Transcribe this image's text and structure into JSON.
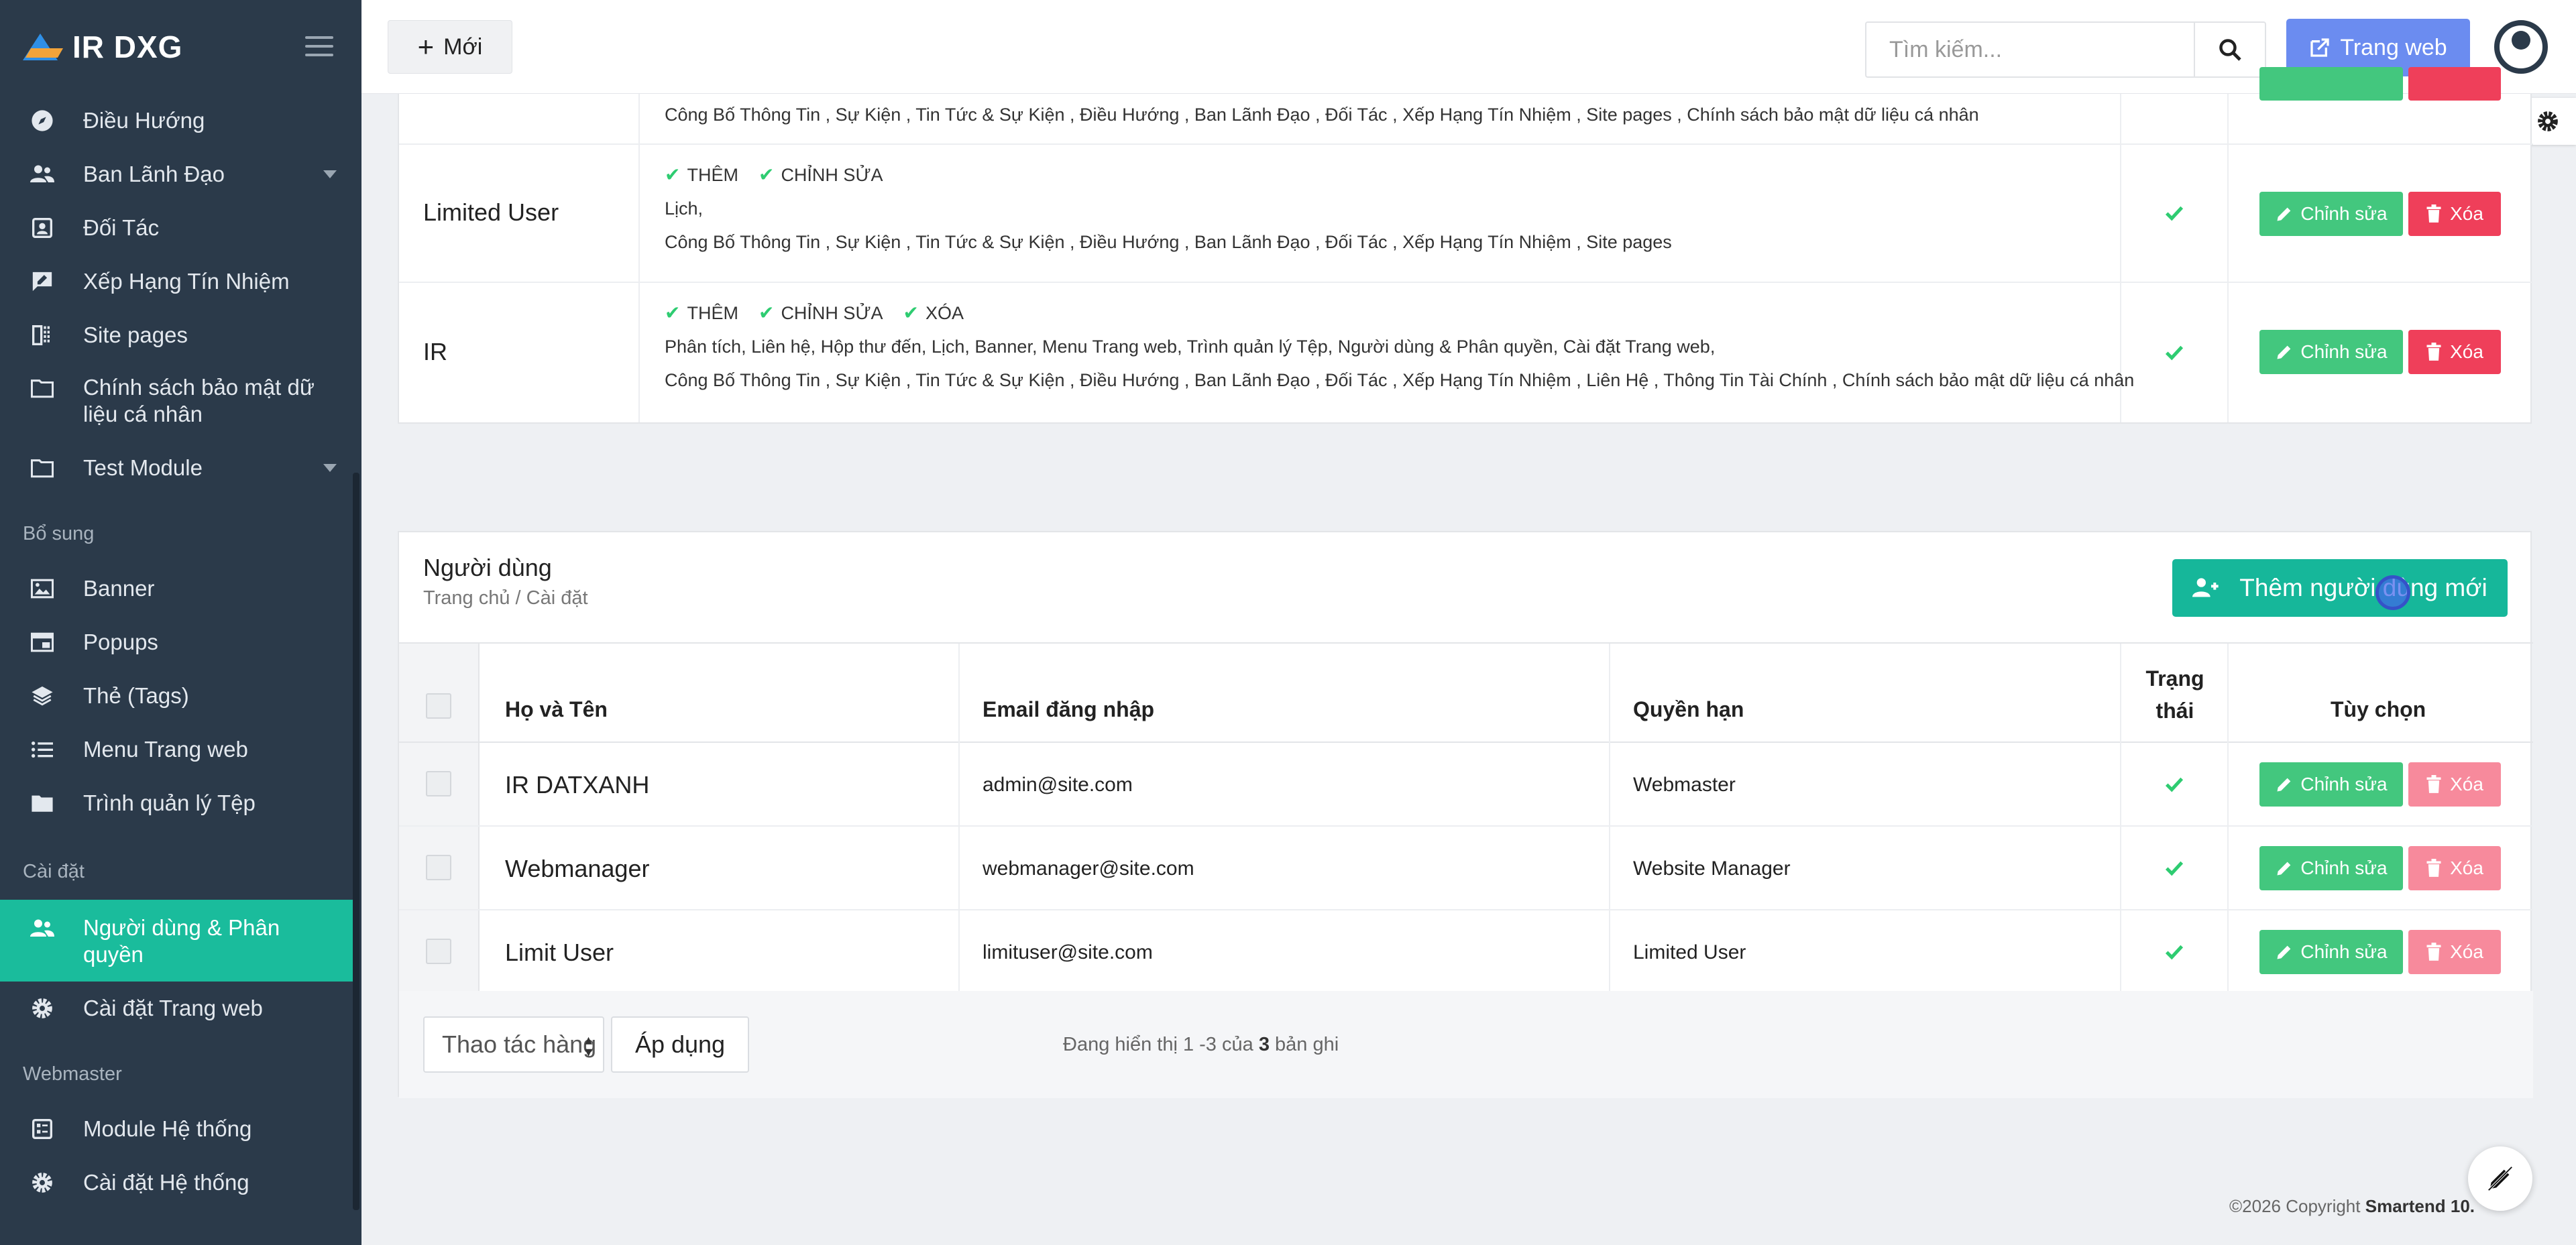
{
  "app": {
    "title": "IR DXG"
  },
  "sidebar": {
    "items": [
      {
        "label": "Điều Hướng",
        "icon": "compass-icon"
      },
      {
        "label": "Ban Lãnh Đạo",
        "icon": "users-icon"
      },
      {
        "label": "Đối Tác",
        "icon": "id-card-icon"
      },
      {
        "label": "Xếp Hạng Tín Nhiệm",
        "icon": "signature-icon"
      },
      {
        "label": "Site pages",
        "icon": "columns-icon"
      },
      {
        "label": "Chính sách bảo mật dữ liệu cá nhân",
        "icon": "folder-icon"
      },
      {
        "label": "Test Module",
        "icon": "folder-icon"
      }
    ],
    "section_extra": "Bổ sung",
    "extra_items": [
      {
        "label": "Banner",
        "icon": "image-icon"
      },
      {
        "label": "Popups",
        "icon": "window-icon"
      },
      {
        "label": "Thẻ (Tags)",
        "icon": "layers-icon"
      },
      {
        "label": "Menu Trang web",
        "icon": "list-icon"
      },
      {
        "label": "Trình quản lý Tệp",
        "icon": "folder-filled-icon"
      }
    ],
    "section_settings": "Cài đặt",
    "settings_items": [
      {
        "label": "Người dùng & Phân quyền",
        "icon": "users-icon"
      },
      {
        "label": "Cài đặt Trang web",
        "icon": "gear-icon"
      }
    ],
    "section_webmaster": "Webmaster",
    "webmaster_items": [
      {
        "label": "Module Hệ thống",
        "icon": "module-icon"
      },
      {
        "label": "Cài đặt Hệ thống",
        "icon": "gear-icon"
      }
    ]
  },
  "header": {
    "new_label": "Mới",
    "search_placeholder": "Tìm kiếm...",
    "website_label": "Trang web"
  },
  "permissions": {
    "top_row_text": "Công Bố Thông Tin , Sự Kiện , Tin Tức & Sự Kiện , Điều Hướng , Ban Lãnh Đạo , Đối Tác , Xếp Hạng Tín Nhiệm , Site pages , Chính sách bảo mật dữ liệu cá nhân",
    "rows": [
      {
        "name": "Limited User",
        "tags": [
          "THÊM",
          "CHỈNH SỬA"
        ],
        "line1": "Lịch,",
        "line2": "Công Bố Thông Tin , Sự Kiện , Tin Tức & Sự Kiện , Điều Hướng , Ban Lãnh Đạo , Đối Tác , Xếp Hạng Tín Nhiệm , Site pages"
      },
      {
        "name": "IR",
        "tags": [
          "THÊM",
          "CHỈNH SỬA",
          "XÓA"
        ],
        "line1": "Phân tích, Liên hệ, Hộp thư đến, Lịch, Banner, Menu Trang web, Trình quản lý Tệp, Người dùng & Phân quyền, Cài đặt Trang web,",
        "line2": "Công Bố Thông Tin , Sự Kiện , Tin Tức & Sự Kiện , Điều Hướng , Ban Lãnh Đạo , Đối Tác , Xếp Hạng Tín Nhiệm , Liên Hệ , Thông Tin Tài Chính , Chính sách bảo mật dữ liệu cá nhân"
      }
    ]
  },
  "actions": {
    "edit_label": "Chỉnh sửa",
    "delete_label": "Xóa"
  },
  "users": {
    "title": "Người dùng",
    "breadcrumb": "Trang chủ / Cài đặt",
    "add_label": "Thêm người dùng mới",
    "columns": {
      "name": "Họ và Tên",
      "email": "Email đăng nhập",
      "role": "Quyền hạn",
      "status": "Trạng thái",
      "options": "Tùy chọn"
    },
    "rows": [
      {
        "name": "IR DATXANH",
        "email": "admin@site.com",
        "role": "Webmaster"
      },
      {
        "name": "Webmanager",
        "email": "webmanager@site.com",
        "role": "Website Manager"
      },
      {
        "name": "Limit User",
        "email": "limituser@site.com",
        "role": "Limited User"
      }
    ],
    "bulk_action_label": "Thao tác hàng loạt",
    "apply_label": "Áp dụng",
    "showing_prefix": "Đang hiển thị 1 -3 của",
    "showing_count": "3",
    "showing_suffix": "bản ghi"
  },
  "footer": {
    "copyright_prefix": "©2026 Copyright",
    "copyright_brand": "Smartend 10."
  },
  "colors": {
    "sidebar": "#2b3a4a",
    "active": "#1abc9c",
    "edit": "#43c77e",
    "delete": "#ef3f5a",
    "primary": "#6b8cf0"
  }
}
